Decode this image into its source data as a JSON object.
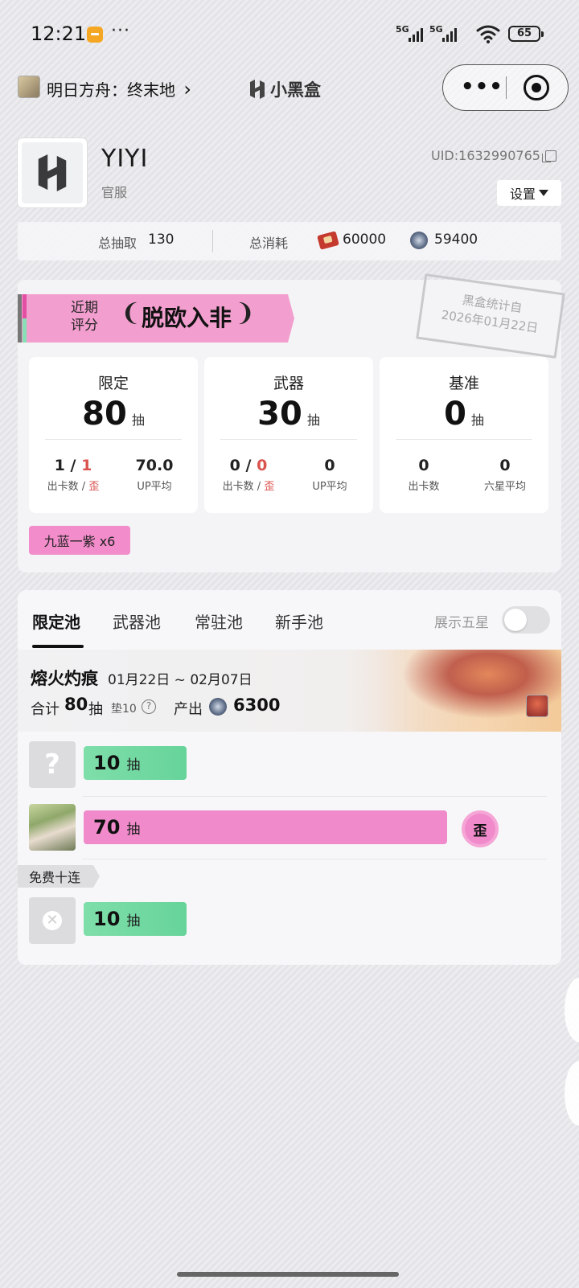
{
  "status_bar": {
    "time": "12:21",
    "more": "···",
    "signal1": "5G",
    "signal2": "5G",
    "battery": "65"
  },
  "nav": {
    "game_title": "明日方舟：终末地",
    "chevron": "›",
    "brand": "小黑盒",
    "capsule_more": "•••"
  },
  "profile": {
    "username": "YIYI",
    "server": "官服",
    "uid": "UID:1632990765",
    "settings_label": "设置"
  },
  "summary": {
    "total_pulls_label": "总抽取",
    "total_pulls_value": "130",
    "total_cost_label": "总消耗",
    "ticket_value": "60000",
    "gem_value": "59400"
  },
  "rating": {
    "label_line1": "近期",
    "label_line2": "评分",
    "value": "脱欧入非",
    "stamp_line1": "黑盒统计自",
    "stamp_line2": "2026年01月22日"
  },
  "stats": [
    {
      "title": "限定",
      "pulls": "80",
      "unit": "抽",
      "left_value_a": "1",
      "left_value_b": "1",
      "left_label_a": "出卡数 /",
      "left_label_b": "歪",
      "right_value": "70.0",
      "right_label": "UP平均"
    },
    {
      "title": "武器",
      "pulls": "30",
      "unit": "抽",
      "left_value_a": "0",
      "left_value_b": "0",
      "left_label_a": "出卡数 /",
      "left_label_b": "歪",
      "right_value": "0",
      "right_label": "UP平均"
    },
    {
      "title": "基准",
      "pulls": "0",
      "unit": "抽",
      "left_value_a": "0",
      "left_label_a": "出卡数",
      "right_value": "0",
      "right_label": "六星平均"
    }
  ],
  "chip": "九蓝一紫 x6",
  "pools": {
    "tabs": [
      "限定池",
      "武器池",
      "常驻池",
      "新手池"
    ],
    "show_5star_label": "展示五星",
    "show_5star_on": false
  },
  "banner": {
    "name": "熔火灼痕",
    "dates": "01月22日 ~ 02月07日",
    "total_label": "合计",
    "total_value": "80",
    "total_unit": "抽",
    "pity": "垫10",
    "help": "?",
    "output_label": "产出",
    "output_value": "6300"
  },
  "pull_rows": [
    {
      "avatar": "?",
      "pulls": "10",
      "unit": "抽",
      "color": "#7fdeaa"
    },
    {
      "avatar": "operator",
      "pulls": "70",
      "unit": "抽",
      "color": "#f08acb",
      "badge": "歪"
    },
    {
      "avatar": "✕",
      "pulls": "10",
      "unit": "抽",
      "color": "#7fdeaa",
      "tag": "免费十连"
    }
  ]
}
